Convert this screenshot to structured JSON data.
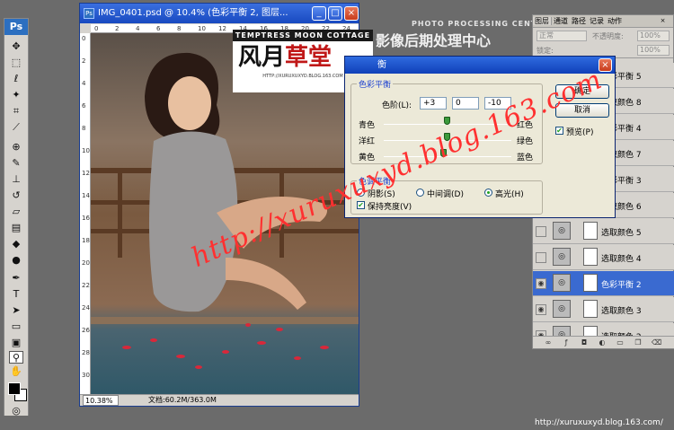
{
  "document": {
    "title": "IMG_0401.psd @ 10.4% (色彩平衡 2, 图层...",
    "zoom": "10.38%",
    "status": "文档:60.2M/363.0M",
    "ruler_top": [
      "0",
      "2",
      "4",
      "6",
      "8",
      "10",
      "12",
      "14",
      "16",
      "18",
      "20",
      "22",
      "24"
    ],
    "ruler_left": [
      "0",
      "2",
      "4",
      "6",
      "8",
      "10",
      "12",
      "14",
      "16",
      "18",
      "20",
      "22",
      "24",
      "26",
      "28",
      "30"
    ]
  },
  "logo": {
    "banner": "TEMPTRESS MOON COTTAGE",
    "callig_black": "风月",
    "callig_red": "草堂",
    "url": "HTTP://XURUXUXYD.BLOG.163.COM"
  },
  "header_watermark": {
    "en": "PHOTO PROCESSING CENTER",
    "cn": "影像后期处理中心"
  },
  "dialog": {
    "title": "衡",
    "balance_legend": "色彩平衡",
    "levels_label": "色阶(L):",
    "levels": [
      "+3",
      "0",
      "-10"
    ],
    "sliders": [
      {
        "left": "青色",
        "right": "红色",
        "pos": 0.503
      },
      {
        "left": "洋红",
        "right": "绿色",
        "pos": 0.5
      },
      {
        "left": "黄色",
        "right": "蓝色",
        "pos": 0.475
      }
    ],
    "tone_legend": "色调平衡",
    "tones": [
      "阴影(S)",
      "中间调(D)",
      "高光(H)"
    ],
    "selected_tone": "高光(H)",
    "preserve_luminosity": "保持亮度(V)",
    "preserve_checked": true,
    "ok": "确定",
    "cancel": "取消",
    "preview": "预览(P)",
    "preview_checked": true
  },
  "layers_panel": {
    "tabs": [
      "图层",
      "通道",
      "路径",
      "记录",
      "动作"
    ],
    "active_tab": "图层",
    "close": "×",
    "blend_mode": "正常",
    "opacity_label": "不透明度:",
    "opacity": "100%",
    "fill": "100%",
    "lock_label": "锁定:",
    "layers": [
      {
        "name": "色彩平衡 5",
        "visible": false,
        "selected": false
      },
      {
        "name": "选取颜色 8",
        "visible": false,
        "selected": false
      },
      {
        "name": "色彩平衡 4",
        "visible": false,
        "selected": false
      },
      {
        "name": "选取颜色 7",
        "visible": false,
        "selected": false
      },
      {
        "name": "色彩平衡 3",
        "visible": false,
        "selected": false
      },
      {
        "name": "选取颜色 6",
        "visible": false,
        "selected": false
      },
      {
        "name": "选取颜色 5",
        "visible": false,
        "selected": false
      },
      {
        "name": "选取颜色 4",
        "visible": false,
        "selected": false
      },
      {
        "name": "色彩平衡 2",
        "visible": true,
        "selected": true
      },
      {
        "name": "选取颜色 3",
        "visible": true,
        "selected": false
      },
      {
        "name": "选取颜色 2",
        "visible": true,
        "selected": false
      }
    ]
  },
  "footer_url": "http://xuruxuxyd.blog.163.com/",
  "watermark_url": "http://xuruxuxyd.blog.163.com"
}
